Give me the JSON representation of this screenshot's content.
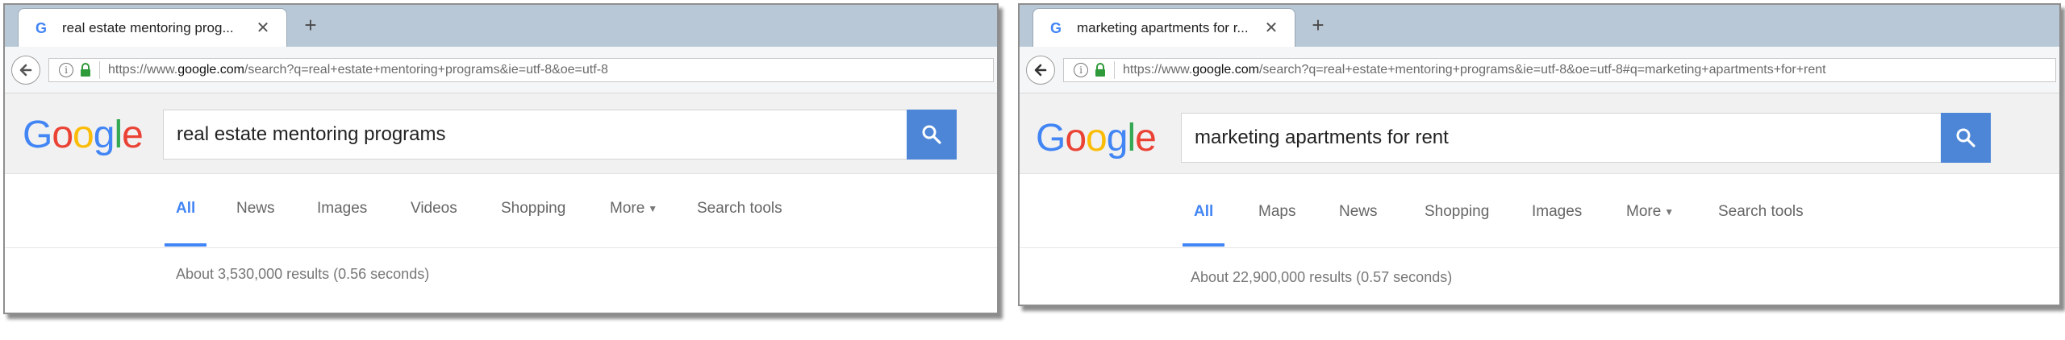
{
  "windows": [
    {
      "tab": {
        "title": "real estate mentoring prog...",
        "close": "✕",
        "new_tab": "+"
      },
      "url": {
        "prefix": "https://www.",
        "domain": "google.com",
        "rest": "/search?q=real+estate+mentoring+programs&ie=utf-8&oe=utf-8"
      },
      "query": "real estate mentoring programs",
      "tabs": [
        "All",
        "News",
        "Images",
        "Videos",
        "Shopping",
        "More",
        "Search tools"
      ],
      "active_tab": "All",
      "results": "About 3,530,000 results (0.56 seconds)"
    },
    {
      "tab": {
        "title": "marketing apartments for r...",
        "close": "✕",
        "new_tab": "+"
      },
      "url": {
        "prefix": "https://www.",
        "domain": "google.com",
        "rest": "/search?q=real+estate+mentoring+programs&ie=utf-8&oe=utf-8#q=marketing+apartments+for+rent"
      },
      "query": "marketing apartments for rent",
      "tabs": [
        "All",
        "Maps",
        "News",
        "Shopping",
        "Images",
        "More",
        "Search tools"
      ],
      "active_tab": "All",
      "results": "About 22,900,000 results (0.57 seconds)"
    }
  ],
  "logo": [
    "G",
    "o",
    "o",
    "g",
    "l",
    "e"
  ],
  "colors": {
    "logo": [
      "#4285f4",
      "#ea4335",
      "#fbbc05",
      "#4285f4",
      "#34a853",
      "#ea4335"
    ],
    "accent": "#4285f4",
    "search_button": "#4d86d6",
    "lock": "#2e9a3a"
  }
}
